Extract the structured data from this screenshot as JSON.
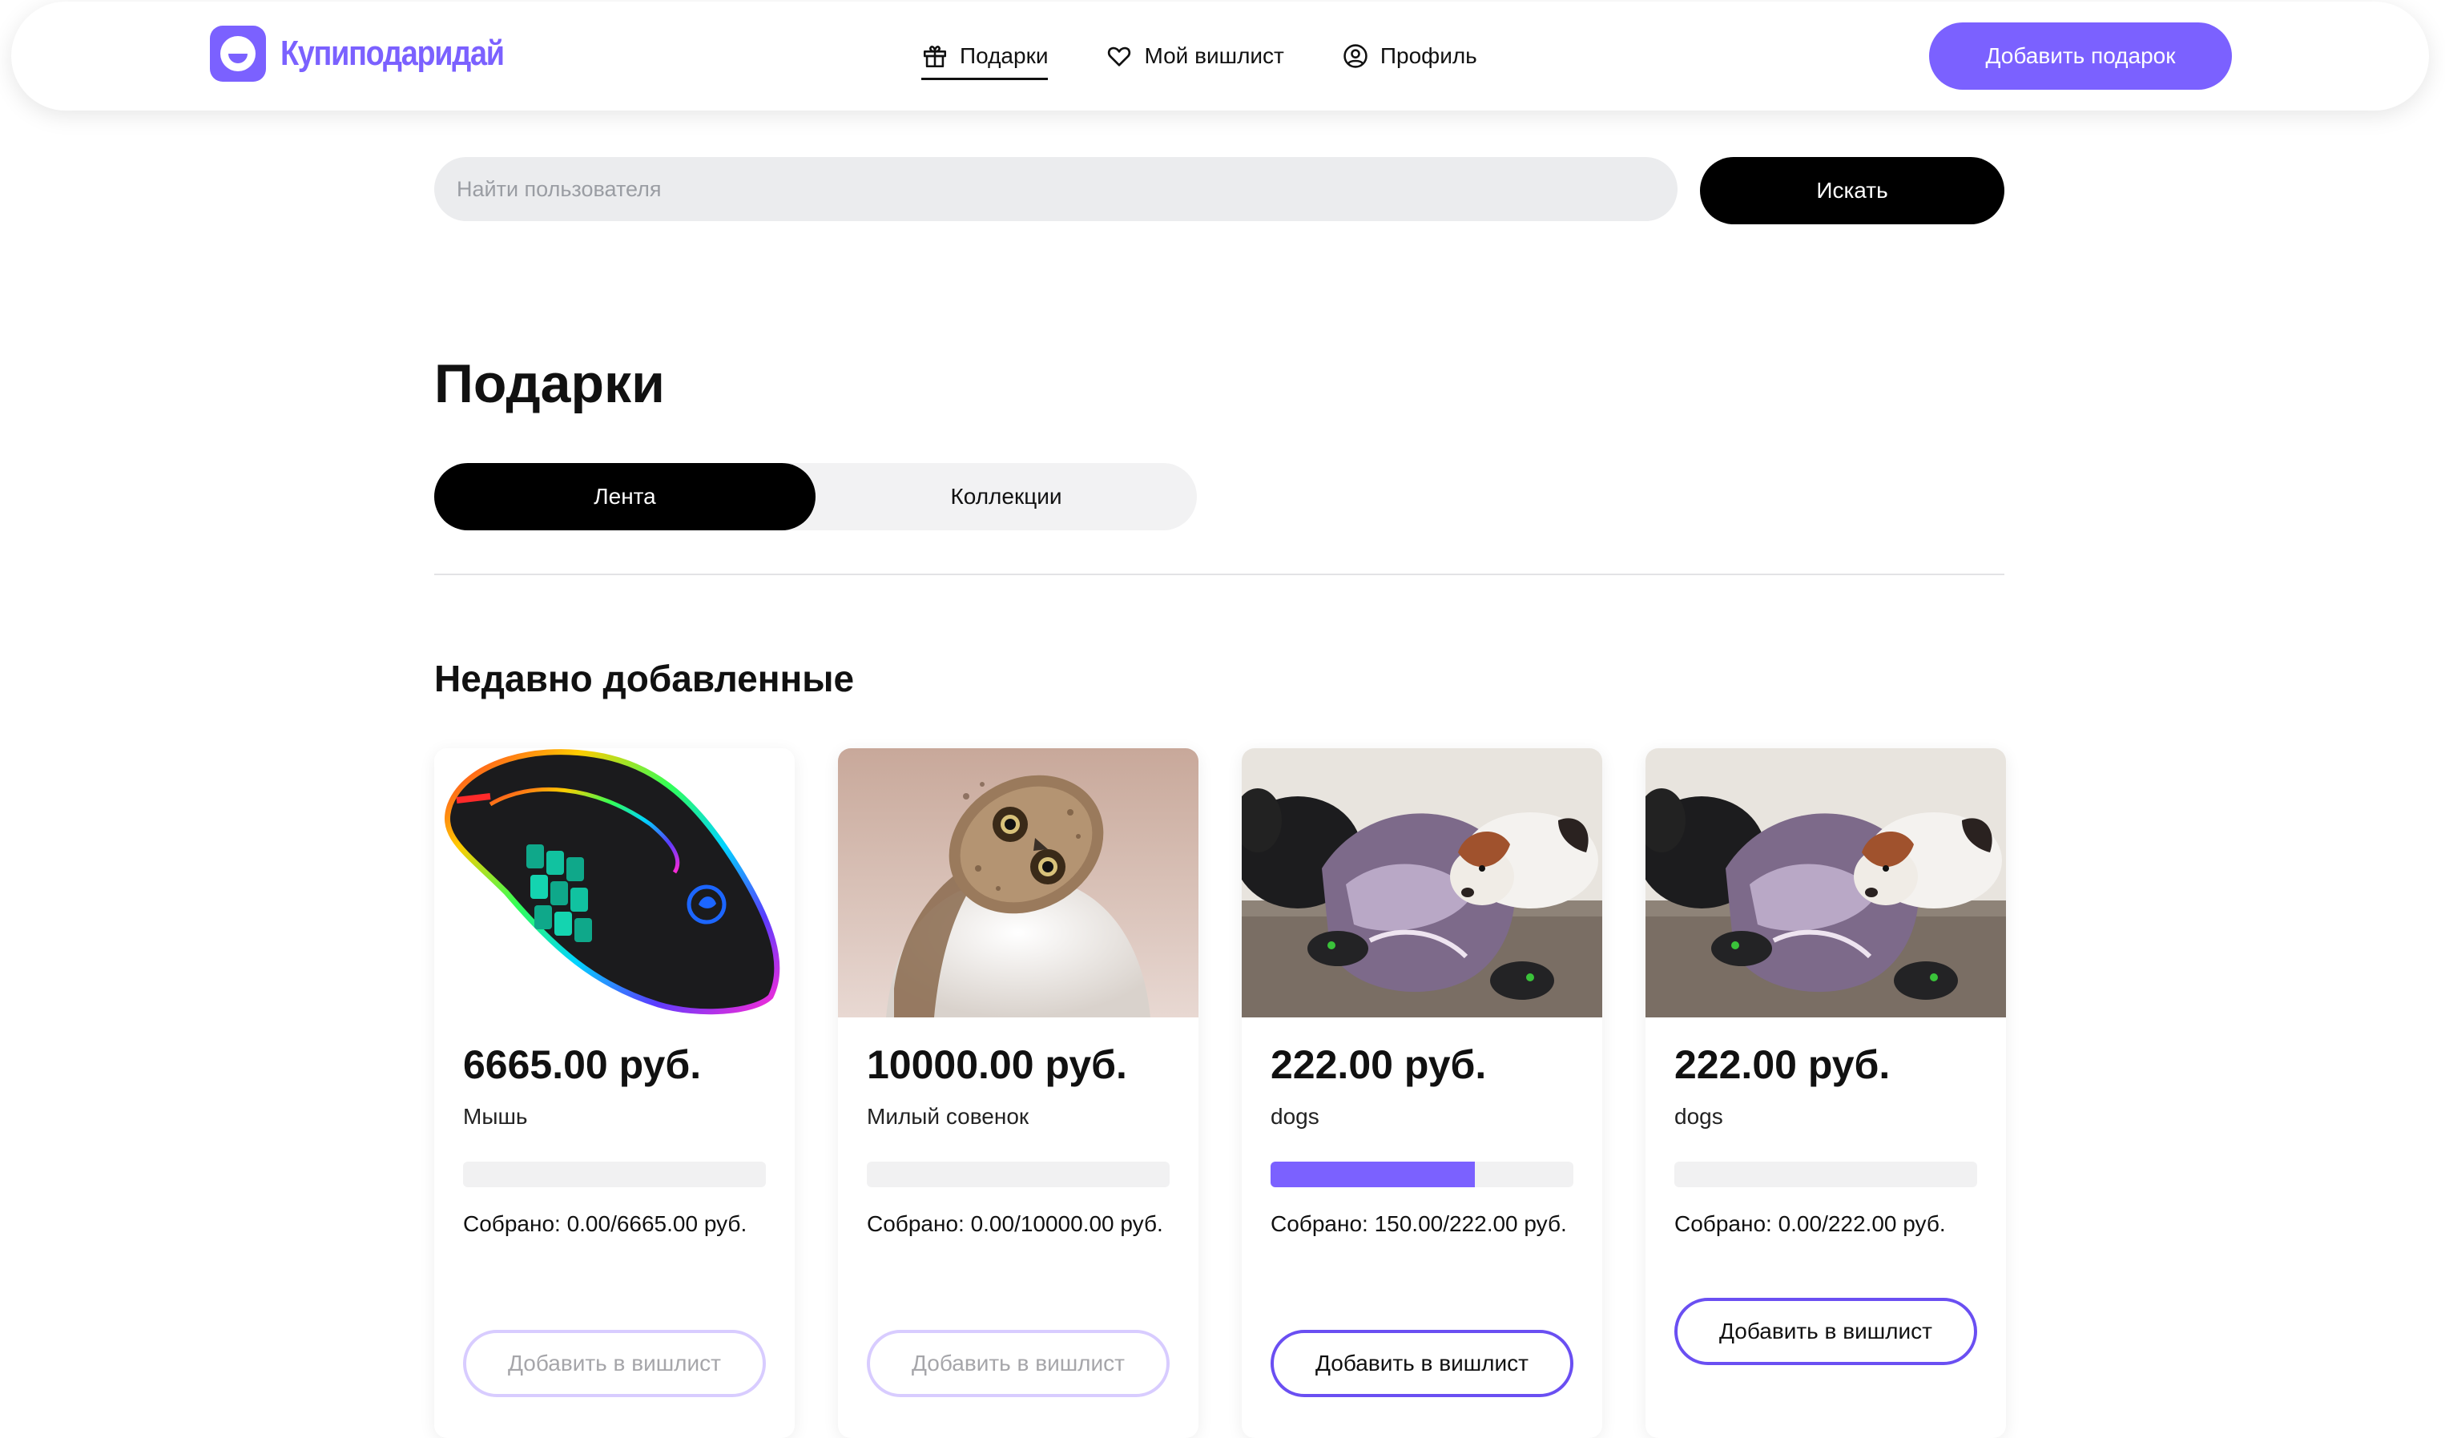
{
  "header": {
    "logo_text": "Купиподаридай",
    "nav": [
      {
        "label": "Подарки",
        "icon": "gift-icon",
        "active": true
      },
      {
        "label": "Мой вишлист",
        "icon": "heart-icon",
        "active": false
      },
      {
        "label": "Профиль",
        "icon": "user-circle-icon",
        "active": false
      }
    ],
    "add_gift_label": "Добавить подарок"
  },
  "search": {
    "placeholder": "Найти пользователя",
    "value": "",
    "button_label": "Искать"
  },
  "page_title": "Подарки",
  "tabs": [
    {
      "label": "Лента",
      "active": true
    },
    {
      "label": "Коллекции",
      "active": false
    }
  ],
  "section_title": "Недавно добавленные",
  "cards": [
    {
      "price": "6665.00 руб.",
      "name": "Мышь",
      "progress": 0.0,
      "collected": "Собрано: 0.00/6665.00 руб.",
      "button_label": "Добавить в вишлист",
      "button_enabled": false,
      "image": "rgb-gaming-mouse"
    },
    {
      "price": "10000.00 руб.",
      "name": "Милый совенок",
      "progress": 0.0,
      "collected": "Собрано: 0.00/10000.00 руб.",
      "button_label": "Добавить в вишлист",
      "button_enabled": false,
      "image": "owl-photo"
    },
    {
      "price": "222.00 руб.",
      "name": "dogs",
      "progress": 0.6757,
      "collected": "Собрано: 150.00/222.00 руб.",
      "button_label": "Добавить в вишлист",
      "button_enabled": true,
      "image": "dogs-photo"
    },
    {
      "price": "222.00 руб.",
      "name": "dogs",
      "progress": 0.0,
      "collected": "Собрано: 0.00/222.00 руб.",
      "button_label": "Добавить в вишлист",
      "button_enabled": true,
      "image": "dogs-photo"
    }
  ],
  "colors": {
    "accent": "#7b61ff",
    "button_border": "#6a4ff2",
    "disabled_border": "#d8ccff"
  }
}
